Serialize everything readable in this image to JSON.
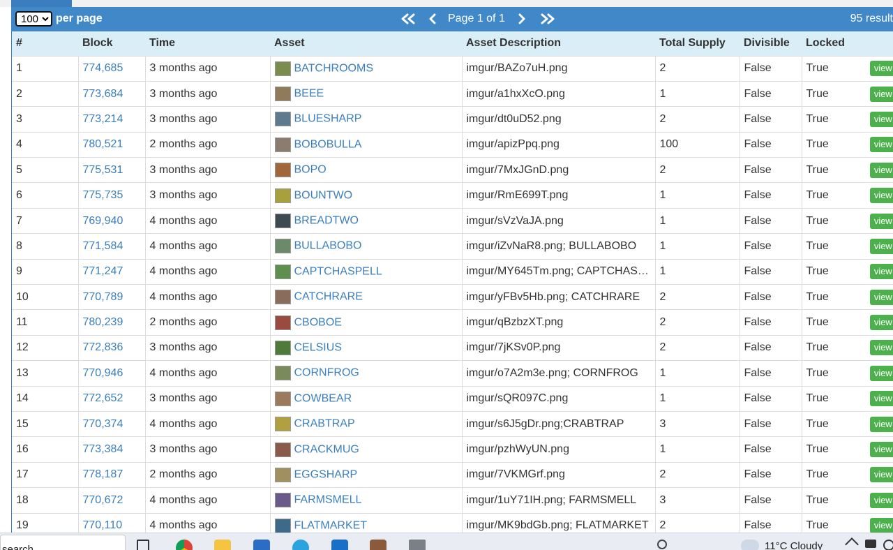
{
  "pager": {
    "per_page_value": "100",
    "per_page_label": "per page",
    "page_label": "Page 1 of 1",
    "results_label": "95 result"
  },
  "table": {
    "headers": [
      "#",
      "Block",
      "Time",
      "Asset",
      "Asset Description",
      "Total Supply",
      "Divisible",
      "Locked"
    ],
    "view_label": "view",
    "rows": [
      {
        "n": "1",
        "block": "774,685",
        "time": "3 months ago",
        "asset": "BATCHROOMS",
        "desc": "imgur/BAZo7uH.png",
        "supply": "2",
        "divisible": "False",
        "locked": "True",
        "thumb_color": "#7a8c4e"
      },
      {
        "n": "2",
        "block": "773,684",
        "time": "3 months ago",
        "asset": "BEEE",
        "desc": "imgur/a1hxXcO.png",
        "supply": "1",
        "divisible": "False",
        "locked": "True",
        "thumb_color": "#8f7a5c"
      },
      {
        "n": "3",
        "block": "773,214",
        "time": "3 months ago",
        "asset": "BLUESHARP",
        "desc": "imgur/dt0uD52.png",
        "supply": "2",
        "divisible": "False",
        "locked": "True",
        "thumb_color": "#5d7a8f"
      },
      {
        "n": "4",
        "block": "780,521",
        "time": "2 months ago",
        "asset": "BOBOBULLA",
        "desc": "imgur/apizPpq.png",
        "supply": "100",
        "divisible": "False",
        "locked": "True",
        "thumb_color": "#8a7d6e"
      },
      {
        "n": "5",
        "block": "775,531",
        "time": "3 months ago",
        "asset": "BOPO",
        "desc": "imgur/7MxJGnD.png",
        "supply": "2",
        "divisible": "False",
        "locked": "True",
        "thumb_color": "#a0683a"
      },
      {
        "n": "6",
        "block": "775,735",
        "time": "3 months ago",
        "asset": "BOUNTWO",
        "desc": "imgur/RmE699T.png",
        "supply": "1",
        "divisible": "False",
        "locked": "True",
        "thumb_color": "#a8a03c"
      },
      {
        "n": "7",
        "block": "769,940",
        "time": "4 months ago",
        "asset": "BREADTWO",
        "desc": "imgur/sVzVaJA.png",
        "supply": "1",
        "divisible": "False",
        "locked": "True",
        "thumb_color": "#3e4a52"
      },
      {
        "n": "8",
        "block": "771,584",
        "time": "4 months ago",
        "asset": "BULLABOBO",
        "desc": "imgur/iZvNaR8.png; BULLABOBO",
        "supply": "1",
        "divisible": "False",
        "locked": "True",
        "thumb_color": "#6c8a6a"
      },
      {
        "n": "9",
        "block": "771,247",
        "time": "4 months ago",
        "asset": "CAPTCHASPELL",
        "desc": "imgur/MY645Tm.png; CAPTCHAS…",
        "supply": "1",
        "divisible": "False",
        "locked": "True",
        "thumb_color": "#5f8f4e"
      },
      {
        "n": "10",
        "block": "770,789",
        "time": "4 months ago",
        "asset": "CATCHRARE",
        "desc": "imgur/yFBv5Hb.png; CATCHRARE",
        "supply": "2",
        "divisible": "False",
        "locked": "True",
        "thumb_color": "#8a6c5a"
      },
      {
        "n": "11",
        "block": "780,239",
        "time": "2 months ago",
        "asset": "CBOBOE",
        "desc": "imgur/qBzbzXT.png",
        "supply": "2",
        "divisible": "False",
        "locked": "True",
        "thumb_color": "#9a4a3e"
      },
      {
        "n": "12",
        "block": "772,836",
        "time": "3 months ago",
        "asset": "CELSIUS",
        "desc": "imgur/7jKSv0P.png",
        "supply": "2",
        "divisible": "False",
        "locked": "True",
        "thumb_color": "#4e7a3a"
      },
      {
        "n": "13",
        "block": "770,946",
        "time": "4 months ago",
        "asset": "CORNFROG",
        "desc": "imgur/o7A2m3e.png; CORNFROG",
        "supply": "1",
        "divisible": "False",
        "locked": "True",
        "thumb_color": "#7a8a5a"
      },
      {
        "n": "14",
        "block": "772,652",
        "time": "3 months ago",
        "asset": "COWBEAR",
        "desc": "imgur/sQR097C.png",
        "supply": "1",
        "divisible": "False",
        "locked": "True",
        "thumb_color": "#9a7a5a"
      },
      {
        "n": "15",
        "block": "770,374",
        "time": "4 months ago",
        "asset": "CRABTRAP",
        "desc": "imgur/s6J5gDr.png;CRABTRAP",
        "supply": "3",
        "divisible": "False",
        "locked": "True",
        "thumb_color": "#b0a040"
      },
      {
        "n": "16",
        "block": "773,384",
        "time": "3 months ago",
        "asset": "CRACKMUG",
        "desc": "imgur/pzhWyUN.png",
        "supply": "1",
        "divisible": "False",
        "locked": "True",
        "thumb_color": "#8a5a4a"
      },
      {
        "n": "17",
        "block": "778,187",
        "time": "2 months ago",
        "asset": "EGGSHARP",
        "desc": "imgur/7VKMGrf.png",
        "supply": "2",
        "divisible": "False",
        "locked": "True",
        "thumb_color": "#a09060"
      },
      {
        "n": "18",
        "block": "770,672",
        "time": "4 months ago",
        "asset": "FARMSMELL",
        "desc": "imgur/1uY71IH.png; FARMSMELL",
        "supply": "3",
        "divisible": "False",
        "locked": "True",
        "thumb_color": "#6a5a8a"
      },
      {
        "n": "19",
        "block": "770,110",
        "time": "4 months ago",
        "asset": "FLATMARKET",
        "desc": "imgur/MK9bdGb.png; FLATMARKET",
        "supply": "2",
        "divisible": "False",
        "locked": "True",
        "thumb_color": "#3e6a8a"
      }
    ]
  },
  "taskbar": {
    "search_text": "search",
    "weather": "11°C  Cloudy"
  },
  "colors": {
    "header_blue": "#4188c8",
    "table_header_bg": "#daeef8",
    "link_blue": "#3a7ebf",
    "view_green": "#4cb14c"
  }
}
